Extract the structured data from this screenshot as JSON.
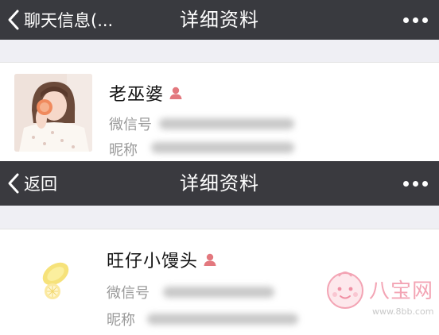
{
  "screens": [
    {
      "nav": {
        "back_label": "聊天信息(...",
        "title": "详细资料"
      },
      "profile": {
        "name": "老巫婆",
        "wechat_id_label": "微信号",
        "nickname_label": "昵称"
      },
      "icons": {
        "back": "chevron-left-icon",
        "more": "more-dots-icon",
        "gender": "female-icon"
      }
    },
    {
      "nav": {
        "back_label": "返回",
        "title": "详细资料"
      },
      "profile": {
        "name": "旺仔小馒头",
        "wechat_id_label": "微信号",
        "nickname_label": "昵称"
      },
      "icons": {
        "back": "chevron-left-icon",
        "more": "more-dots-icon",
        "gender": "female-icon"
      }
    }
  ],
  "watermark": {
    "text": "八宝网",
    "url": "www.8bb.com"
  },
  "colors": {
    "navbar": "#393a3f",
    "background": "#efeff4",
    "gender_icon": "#e3787e",
    "watermark": "#f3a4b4"
  }
}
